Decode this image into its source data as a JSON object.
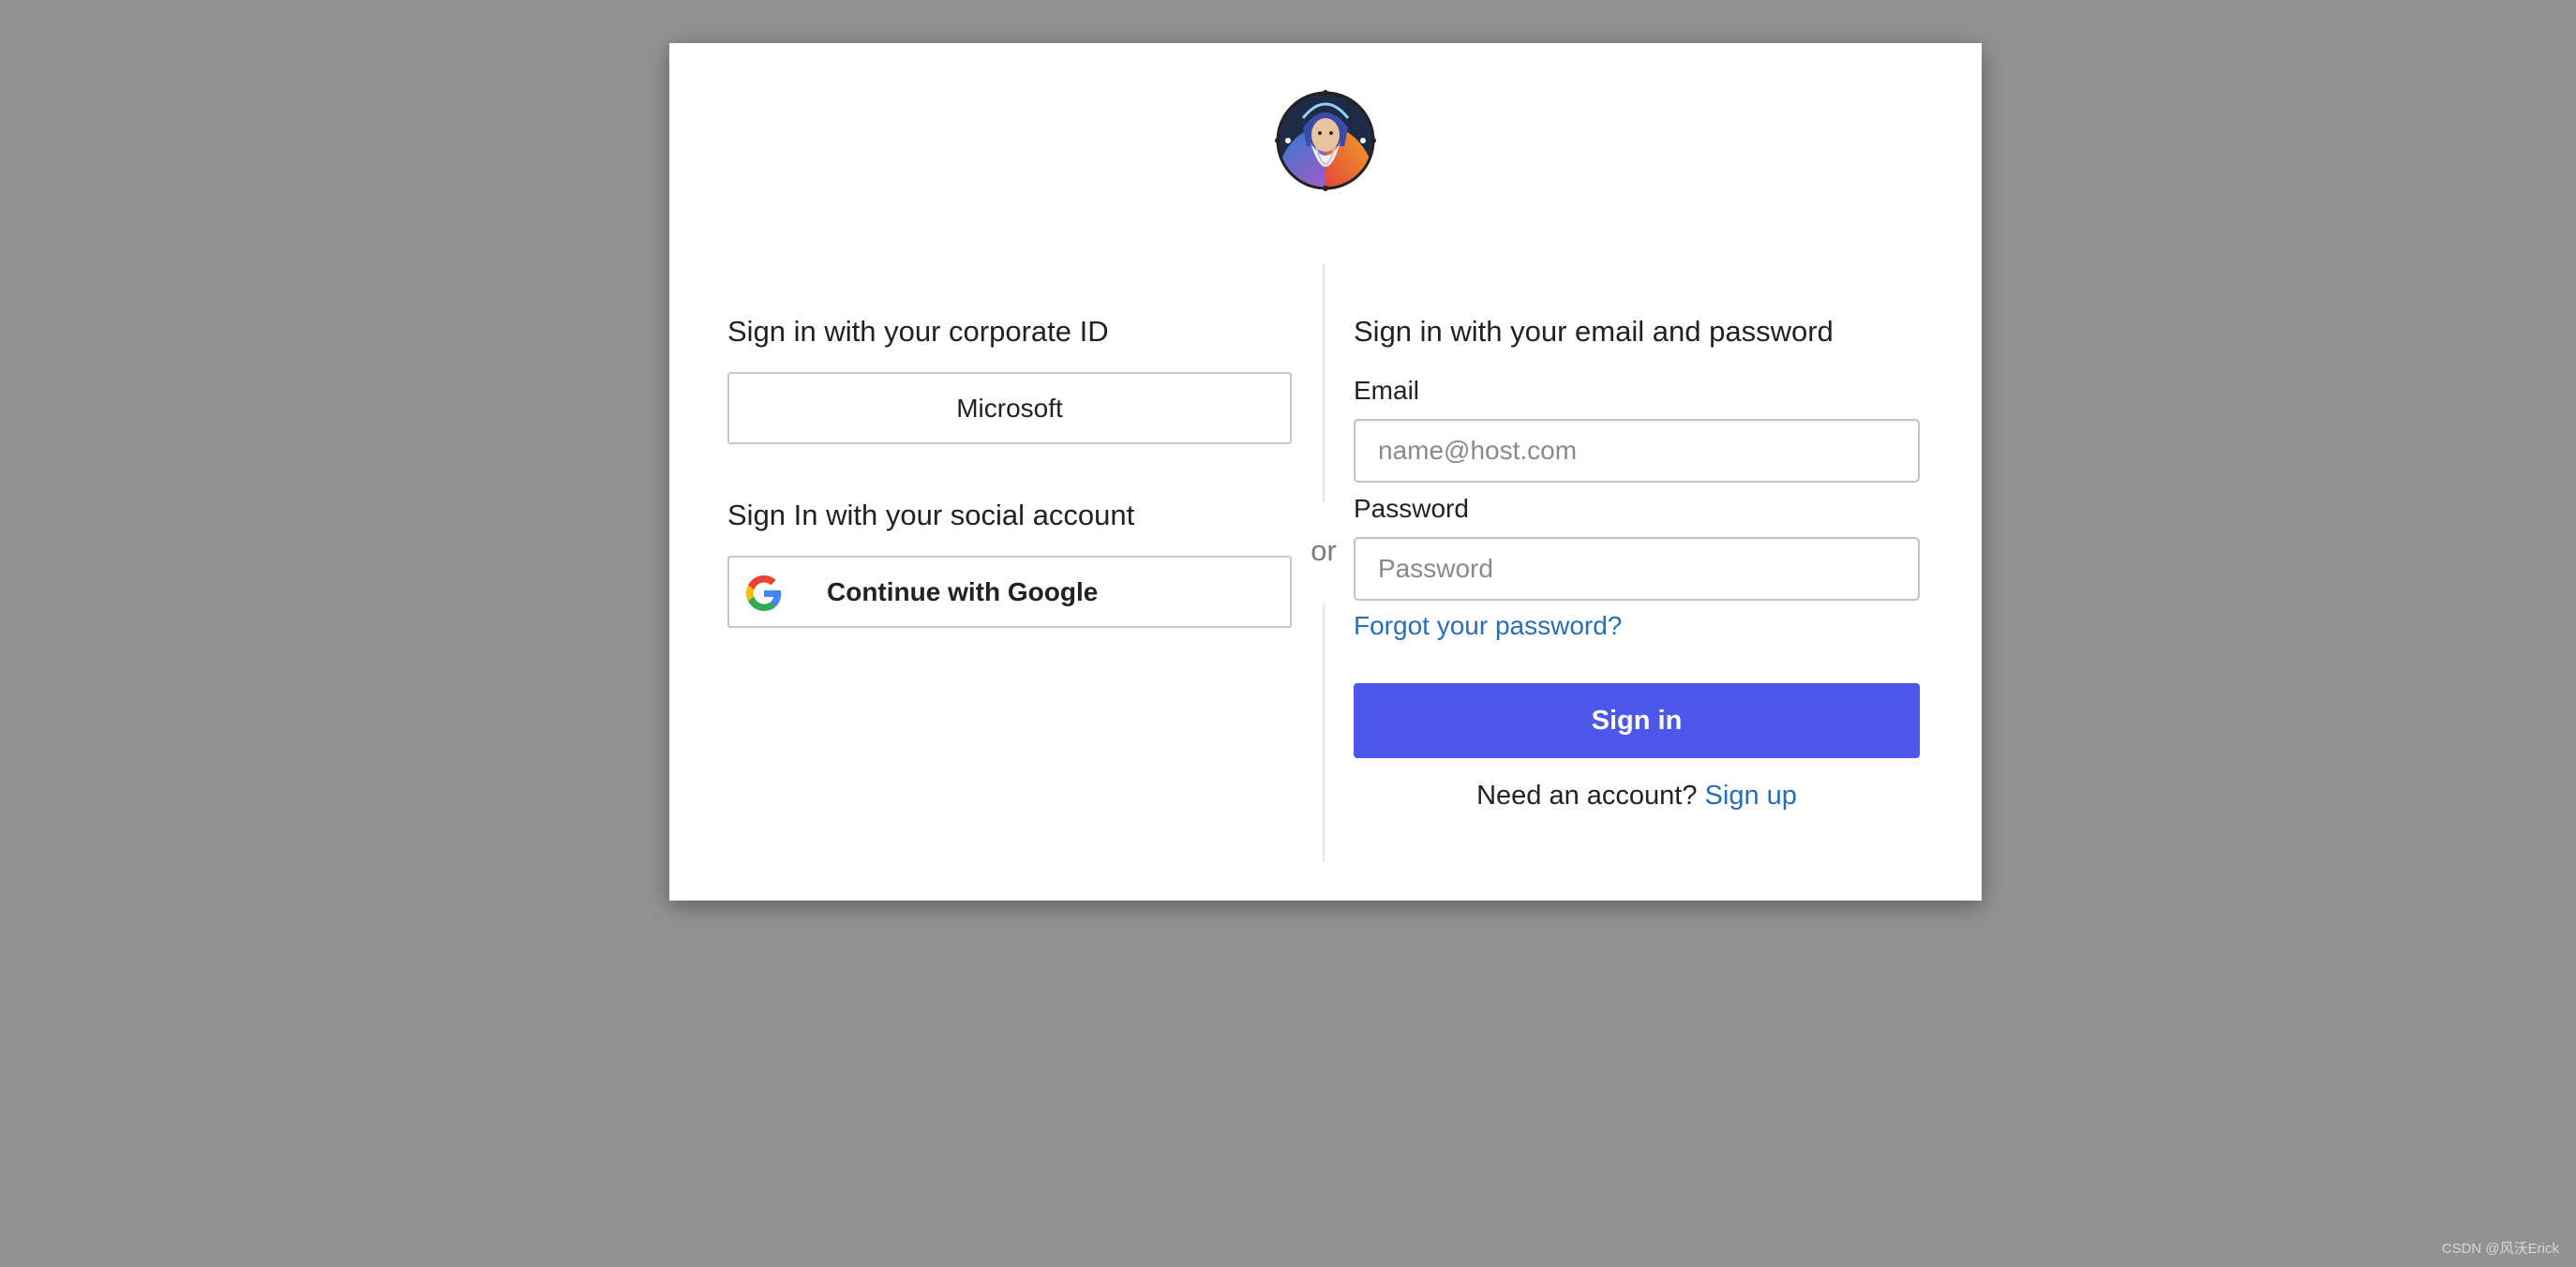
{
  "page": {
    "background_color": "#929292",
    "watermark": "CSDN @风沃Erick"
  },
  "logo": {
    "icon": "wizard-avatar-logo"
  },
  "corporate": {
    "heading": "Sign in with your corporate ID",
    "microsoft_button": "Microsoft"
  },
  "social": {
    "heading": "Sign In with your social account",
    "google_button": "Continue with Google",
    "google_icon": "google-g-icon"
  },
  "divider": {
    "or_text": "or"
  },
  "email_signin": {
    "heading": "Sign in with your email and password",
    "email_label": "Email",
    "email_placeholder": "name@host.com",
    "email_value": "",
    "password_label": "Password",
    "password_placeholder": "Password",
    "password_value": "",
    "forgot_link": "Forgot your password?",
    "signin_button": "Sign in",
    "signup_prompt": "Need an account?",
    "signup_link": "Sign up"
  },
  "colors": {
    "primary": "#4b58eb",
    "link": "#2a6db5"
  }
}
